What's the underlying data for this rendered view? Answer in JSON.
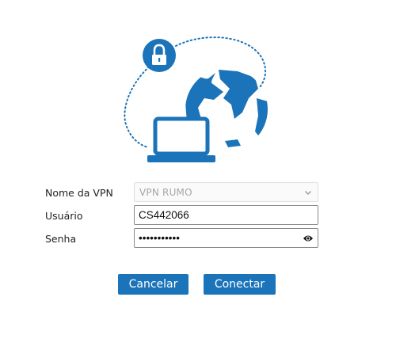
{
  "illustration": {
    "icons": [
      "globe-icon",
      "laptop-icon",
      "lock-icon"
    ],
    "accent_color": "#1b74b9"
  },
  "form": {
    "vpn_label": "Nome da VPN",
    "vpn_value": "VPN RUMO",
    "user_label": "Usuário",
    "user_value": "CS442066",
    "password_label": "Senha",
    "password_value": "***********"
  },
  "buttons": {
    "cancel_label": "Cancelar",
    "connect_label": "Conectar"
  }
}
